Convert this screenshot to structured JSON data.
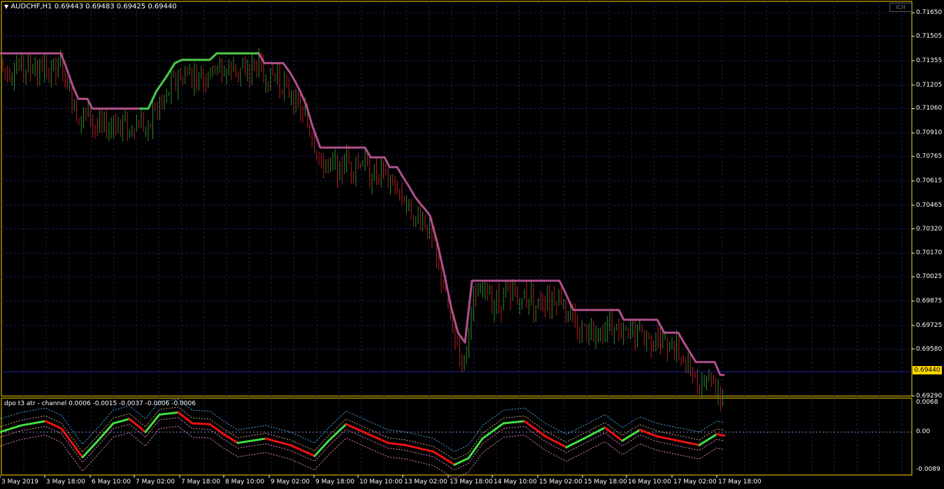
{
  "header": {
    "symbol": "AUDCHF,H1",
    "ohlc": "0.69443 0.69483 0.69425 0.69440",
    "ich_button": "ICH"
  },
  "indicator": {
    "title": "dpo t3 atr - channel 0.0006 -0.0015 -0.0037 -0.0006 -0.0006",
    "levels": [
      "0.0068",
      "0.00",
      "-0.0089"
    ]
  },
  "price_axis": [
    "0.71650",
    "0.71505",
    "0.71355",
    "0.71205",
    "0.71060",
    "0.70910",
    "0.70765",
    "0.70615",
    "0.70465",
    "0.70320",
    "0.70170",
    "0.70025",
    "0.69875",
    "0.69725",
    "0.69580",
    "0.69290"
  ],
  "current_price": "0.69440",
  "time_axis": [
    "3 May 2019",
    "3 May 18:00",
    "6 May 10:00",
    "7 May 02:00",
    "7 May 18:00",
    "8 May 10:00",
    "9 May 02:00",
    "9 May 18:00",
    "10 May 10:00",
    "13 May 02:00",
    "13 May 18:00",
    "14 May 10:00",
    "15 May 02:00",
    "15 May 18:00",
    "16 May 10:00",
    "17 May 02:00",
    "17 May 18:00"
  ],
  "colors": {
    "background": "#000000",
    "grid": "#1c1c5c",
    "bull_candle": "#2e8b2e",
    "bear_candle": "#b22222",
    "channel_main": "#b0508a",
    "channel_up": "#44c844",
    "osc_up": "#44dd44",
    "osc_down": "#ee1111",
    "bid_line": "#2020a0",
    "frame": "#ffd700"
  },
  "chart_data": {
    "type": "line",
    "title": "AUDCHF,H1",
    "ylim": [
      0.6929,
      0.7172
    ],
    "channel": [
      [
        0,
        0.714
      ],
      [
        87,
        0.714
      ],
      [
        95,
        0.7131
      ],
      [
        104,
        0.712
      ],
      [
        112,
        0.7112
      ],
      [
        125,
        0.7112
      ],
      [
        132,
        0.7106
      ],
      [
        200,
        0.7106
      ],
      [
        212,
        0.7106
      ],
      [
        224,
        0.7117
      ],
      [
        237,
        0.7125
      ],
      [
        250,
        0.7134
      ],
      [
        260,
        0.7136
      ],
      [
        300,
        0.7136
      ],
      [
        310,
        0.714
      ],
      [
        370,
        0.714
      ],
      [
        378,
        0.7134
      ],
      [
        405,
        0.7134
      ],
      [
        415,
        0.7128
      ],
      [
        423,
        0.7122
      ],
      [
        430,
        0.7116
      ],
      [
        438,
        0.7108
      ],
      [
        447,
        0.7095
      ],
      [
        458,
        0.7082
      ],
      [
        522,
        0.7082
      ],
      [
        530,
        0.7076
      ],
      [
        550,
        0.7076
      ],
      [
        557,
        0.707
      ],
      [
        568,
        0.707
      ],
      [
        576,
        0.7064
      ],
      [
        585,
        0.7058
      ],
      [
        593,
        0.7052
      ],
      [
        600,
        0.7048
      ],
      [
        608,
        0.7044
      ],
      [
        615,
        0.704
      ],
      [
        625,
        0.7024
      ],
      [
        635,
        0.7005
      ],
      [
        645,
        0.6984
      ],
      [
        655,
        0.6968
      ],
      [
        665,
        0.6962
      ],
      [
        675,
        0.7
      ],
      [
        800,
        0.7
      ],
      [
        808,
        0.6993
      ],
      [
        820,
        0.6982
      ],
      [
        885,
        0.6982
      ],
      [
        892,
        0.6976
      ],
      [
        940,
        0.6976
      ],
      [
        950,
        0.6968
      ],
      [
        970,
        0.6968
      ],
      [
        978,
        0.6962
      ],
      [
        988,
        0.6955
      ],
      [
        995,
        0.695
      ],
      [
        1022,
        0.695
      ],
      [
        1030,
        0.6942
      ],
      [
        1036,
        0.6942
      ]
    ],
    "candles": "generated trend series ending at 0.69440",
    "oscillator_ylim": [
      -0.0089,
      0.0068
    ]
  }
}
